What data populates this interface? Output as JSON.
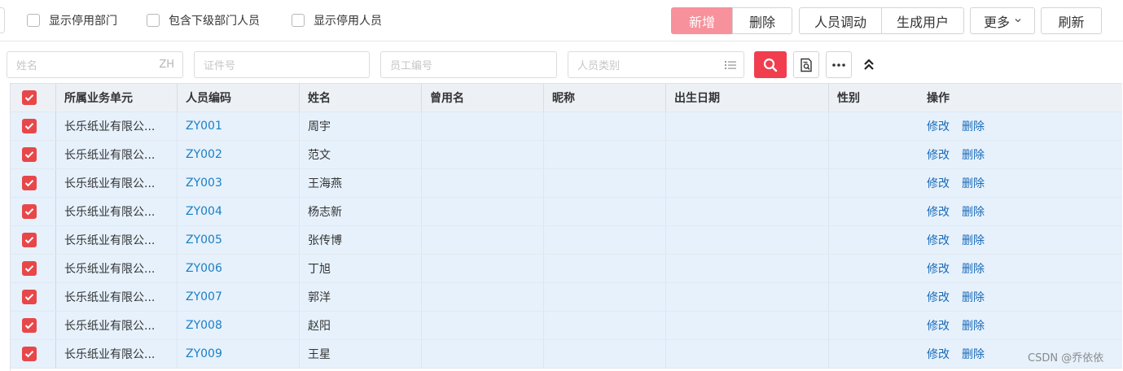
{
  "toolbar": {
    "options": [
      {
        "label": "显示停用部门",
        "checked": false
      },
      {
        "label": "包含下级部门人员",
        "checked": false
      },
      {
        "label": "显示停用人员",
        "checked": false
      }
    ],
    "add_label": "新增",
    "delete_label": "删除",
    "transfer_label": "人员调动",
    "generate_user_label": "生成用户",
    "more_label": "更多",
    "refresh_label": "刷新"
  },
  "filters": {
    "name_placeholder": "姓名",
    "name_suffix": "ZH",
    "id_placeholder": "证件号",
    "employee_no_placeholder": "员工编号",
    "category_placeholder": "人员类别"
  },
  "table": {
    "columns": [
      "所属业务单元",
      "人员编码",
      "姓名",
      "曾用名",
      "昵称",
      "出生日期",
      "性别",
      "操作"
    ],
    "edit_label": "修改",
    "delete_label": "删除",
    "rows": [
      {
        "unit": "长乐纸业有限公...",
        "code": "ZY001",
        "name": "周宇",
        "former_name": "",
        "nickname": "",
        "birth": "",
        "gender": ""
      },
      {
        "unit": "长乐纸业有限公...",
        "code": "ZY002",
        "name": "范文",
        "former_name": "",
        "nickname": "",
        "birth": "",
        "gender": ""
      },
      {
        "unit": "长乐纸业有限公...",
        "code": "ZY003",
        "name": "王海燕",
        "former_name": "",
        "nickname": "",
        "birth": "",
        "gender": ""
      },
      {
        "unit": "长乐纸业有限公...",
        "code": "ZY004",
        "name": "杨志新",
        "former_name": "",
        "nickname": "",
        "birth": "",
        "gender": ""
      },
      {
        "unit": "长乐纸业有限公...",
        "code": "ZY005",
        "name": "张传博",
        "former_name": "",
        "nickname": "",
        "birth": "",
        "gender": ""
      },
      {
        "unit": "长乐纸业有限公...",
        "code": "ZY006",
        "name": "丁旭",
        "former_name": "",
        "nickname": "",
        "birth": "",
        "gender": ""
      },
      {
        "unit": "长乐纸业有限公...",
        "code": "ZY007",
        "name": "郭洋",
        "former_name": "",
        "nickname": "",
        "birth": "",
        "gender": ""
      },
      {
        "unit": "长乐纸业有限公...",
        "code": "ZY008",
        "name": "赵阳",
        "former_name": "",
        "nickname": "",
        "birth": "",
        "gender": ""
      },
      {
        "unit": "长乐纸业有限公...",
        "code": "ZY009",
        "name": "王星",
        "former_name": "",
        "nickname": "",
        "birth": "",
        "gender": ""
      }
    ]
  },
  "colors": {
    "primary": "#f7919b",
    "search": "#f03e4e",
    "checkbox": "#e8474a",
    "link": "#1a7fc4",
    "row_bg": "#e6f1fc",
    "header_bg": "#edf1f6"
  },
  "icons": [
    "check-icon",
    "search-icon",
    "preview-icon",
    "more-dots-icon",
    "collapse-up-icon",
    "list-icon",
    "chevron-down-icon"
  ],
  "watermark": "CSDN @乔依依"
}
